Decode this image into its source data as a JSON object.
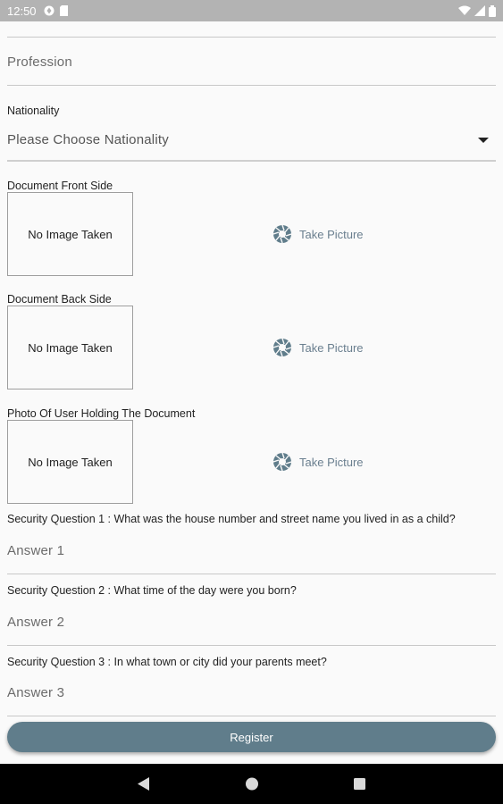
{
  "status_bar": {
    "time": "12:50",
    "icons": [
      "app-notification-icon",
      "sd-card-icon"
    ],
    "right_icons": [
      "wifi-icon",
      "signal-icon",
      "battery-icon"
    ]
  },
  "form": {
    "profession_placeholder": "Profession",
    "nationality_label": "Nationality",
    "nationality_value": "Please Choose Nationality",
    "documents": [
      {
        "label": "Document Front Side",
        "placeholder": "No Image Taken",
        "action": "Take Picture"
      },
      {
        "label": "Document Back Side",
        "placeholder": "No Image Taken",
        "action": "Take Picture"
      },
      {
        "label": "Photo Of User Holding The Document",
        "placeholder": "No Image Taken",
        "action": "Take Picture"
      }
    ],
    "security_questions": [
      {
        "question": "Security Question 1 : What was the house number and street name you lived in as a child?",
        "answer_placeholder": "Answer 1"
      },
      {
        "question": "Security Question 2 : What time of the day were you born?",
        "answer_placeholder": "Answer 2"
      },
      {
        "question": "Security Question 3 : In what town or city did your parents meet?",
        "answer_placeholder": "Answer 3"
      }
    ],
    "register_label": "Register"
  },
  "colors": {
    "accent": "#607d8b",
    "take_picture": "#6a7f8f",
    "status_bar": "#b3b3b3",
    "nav_bar": "#000000"
  }
}
